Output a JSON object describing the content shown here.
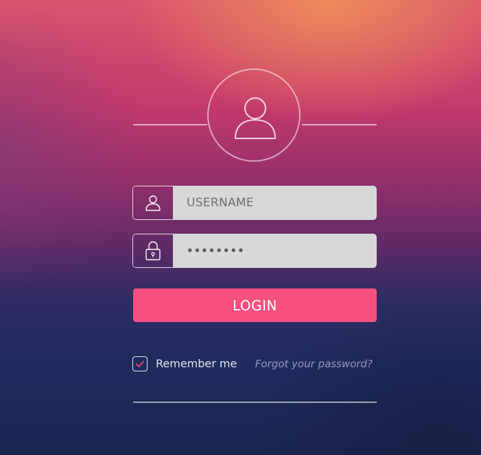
{
  "form": {
    "username_placeholder": "USERNAME",
    "password_value": "••••••••",
    "login_label": "LOGIN",
    "remember_label": "Remember me",
    "remember_checked": true,
    "forgot_label": "Forgot your password?"
  },
  "icons": {
    "avatar": "user-icon",
    "username": "user-icon",
    "password": "lock-icon",
    "checkbox": "check-icon"
  },
  "colors": {
    "accent": "#f7507f",
    "field_background": "#d8d8d8",
    "check_mark": "#f7507f"
  }
}
